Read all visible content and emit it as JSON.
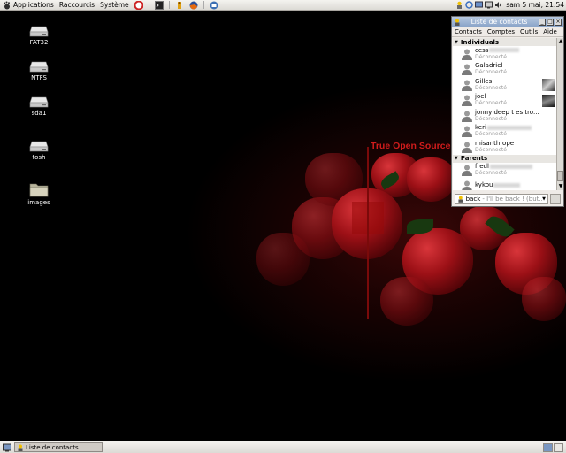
{
  "top_panel": {
    "menus": [
      "Applications",
      "Raccourcis",
      "Système"
    ],
    "launchers": [
      "help-icon",
      "terminal-icon",
      "notes-icon",
      "firefox-icon",
      "thunderbird-icon"
    ],
    "tray_icons": [
      "gaim-tray-icon",
      "update-icon",
      "network-icon",
      "display-icon",
      "volume-icon"
    ],
    "clock": "sam  5 mai, 21:54"
  },
  "desktop": {
    "icons": [
      {
        "label": "FAT32",
        "icon": "drive-icon"
      },
      {
        "label": "NTFS",
        "icon": "drive-icon"
      },
      {
        "label": "sda1",
        "icon": "drive-icon"
      },
      {
        "label": "tosh",
        "icon": "drive-icon"
      },
      {
        "label": "images",
        "icon": "folder-icon"
      }
    ],
    "wallpaper_text": "True Open Source"
  },
  "contacts_window": {
    "title": "Liste de contacts",
    "menu": [
      "Contacts",
      "Comptes",
      "Outils",
      "Aide"
    ],
    "groups": [
      {
        "name": "Individuals",
        "contacts": [
          {
            "name": "cess",
            "status": "Déconnecté",
            "redacted": true
          },
          {
            "name": "Galadriel",
            "status": "Déconnecté"
          },
          {
            "name": "Gilles",
            "status": "Déconnecté",
            "buddy_icon": true
          },
          {
            "name": "joel",
            "status": "Déconnecté",
            "buddy_icon": true
          },
          {
            "name": "jonny deep t es tro...",
            "status": "Déconnecté"
          },
          {
            "name": "keri",
            "status": "Déconnecté",
            "redacted": true
          },
          {
            "name": "misanthrope",
            "status": "Déconnecté"
          }
        ]
      },
      {
        "name": "Parents",
        "contacts": [
          {
            "name": "fredl",
            "status": "Déconnecté",
            "redacted": true
          },
          {
            "name": "kykou",
            "status": "",
            "redacted": true
          }
        ]
      }
    ],
    "status_selector": {
      "value": "back",
      "message": "- I'll be back ! (but..."
    }
  },
  "bottom_panel": {
    "tasks": [
      {
        "label": "Liste de contacts"
      }
    ]
  },
  "colors": {
    "accent": "#d11c1c",
    "titlebar": "#8aa4c8",
    "panel": "#dcdad5"
  }
}
